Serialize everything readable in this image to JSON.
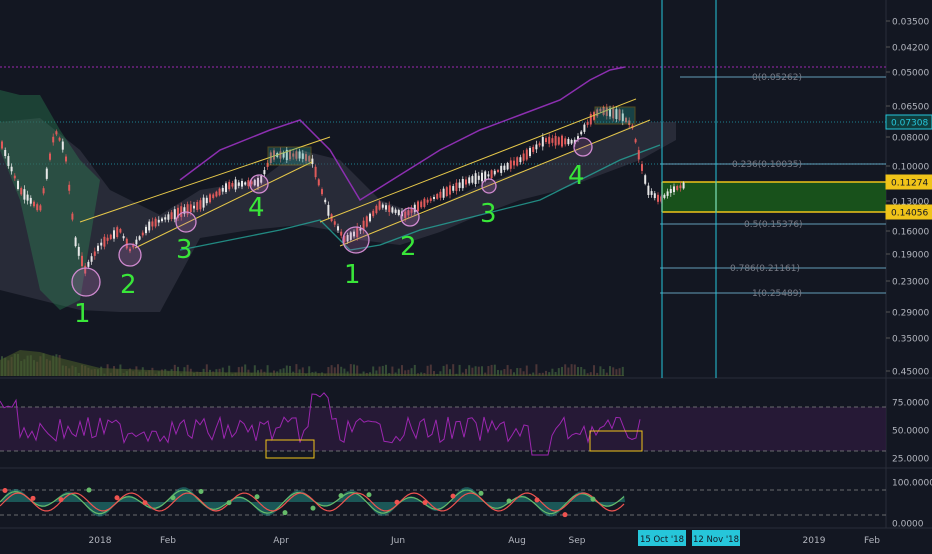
{
  "colors": {
    "background": "#131722",
    "grid": "#1e2230",
    "axis_text": "#b2b5be",
    "candle_up": "#e05a5a",
    "candle_down": "#e8e8e8",
    "channel": "#e6c84a",
    "counts": "#39e639",
    "fib_line": "#5b8fa8",
    "fib_text": "#787b86",
    "bollinger": "#8c2fb0",
    "cloud": "#3a3d4a",
    "cloud_edge": "#2f8f5a",
    "cyan": "#26c6da",
    "purple_line": "#9c27b0",
    "highlight_yellow": "#f0c419",
    "target_box": "#1a5c1a",
    "rsi_line": "#9c27b0",
    "rsi_band": "#2d1b3d",
    "osc_teal": "#26a69a",
    "osc_red": "#ef5350",
    "osc_green": "#66bb6a"
  },
  "chart_data": {
    "type": "candlestick",
    "title": "",
    "price_axis": {
      "scale": "log-inverted",
      "ticks": [
        "0.03500",
        "0.04200",
        "0.05000",
        "0.06500",
        "0.08000",
        "0.10000",
        "0.13000",
        "0.16000",
        "0.19000",
        "0.23000",
        "0.29000",
        "0.35000",
        "0.45000"
      ],
      "price_labels": [
        "0.07308",
        "0.11274",
        "0.14056"
      ]
    },
    "time_axis": {
      "ticks": [
        "2018",
        "Feb",
        "Apr",
        "Jun",
        "Aug",
        "Sep",
        "2019",
        "Feb"
      ],
      "cursor_labels": [
        "15 Oct '18",
        "12 Nov '18"
      ]
    },
    "fibonacci": [
      {
        "label": "0(0.05262)",
        "value": 0.05262
      },
      {
        "label": "0.236(0.10035)",
        "value": 0.10035
      },
      {
        "label": "0.5(0.15376)",
        "value": 0.15376
      },
      {
        "label": "0.786(0.21161)",
        "value": 0.21161
      },
      {
        "label": "1(0.25489)",
        "value": 0.25489
      }
    ],
    "wave_counts": {
      "first_channel": [
        "1",
        "2",
        "3",
        "4"
      ],
      "second_channel": [
        "1",
        "2",
        "3",
        "4"
      ]
    },
    "rsi": {
      "ticks": [
        "75.0000",
        "50.0000",
        "25.0000"
      ],
      "upper": 70,
      "lower": 30
    },
    "oscillator": {
      "ticks": [
        "100.0000",
        "0.0000"
      ]
    }
  }
}
